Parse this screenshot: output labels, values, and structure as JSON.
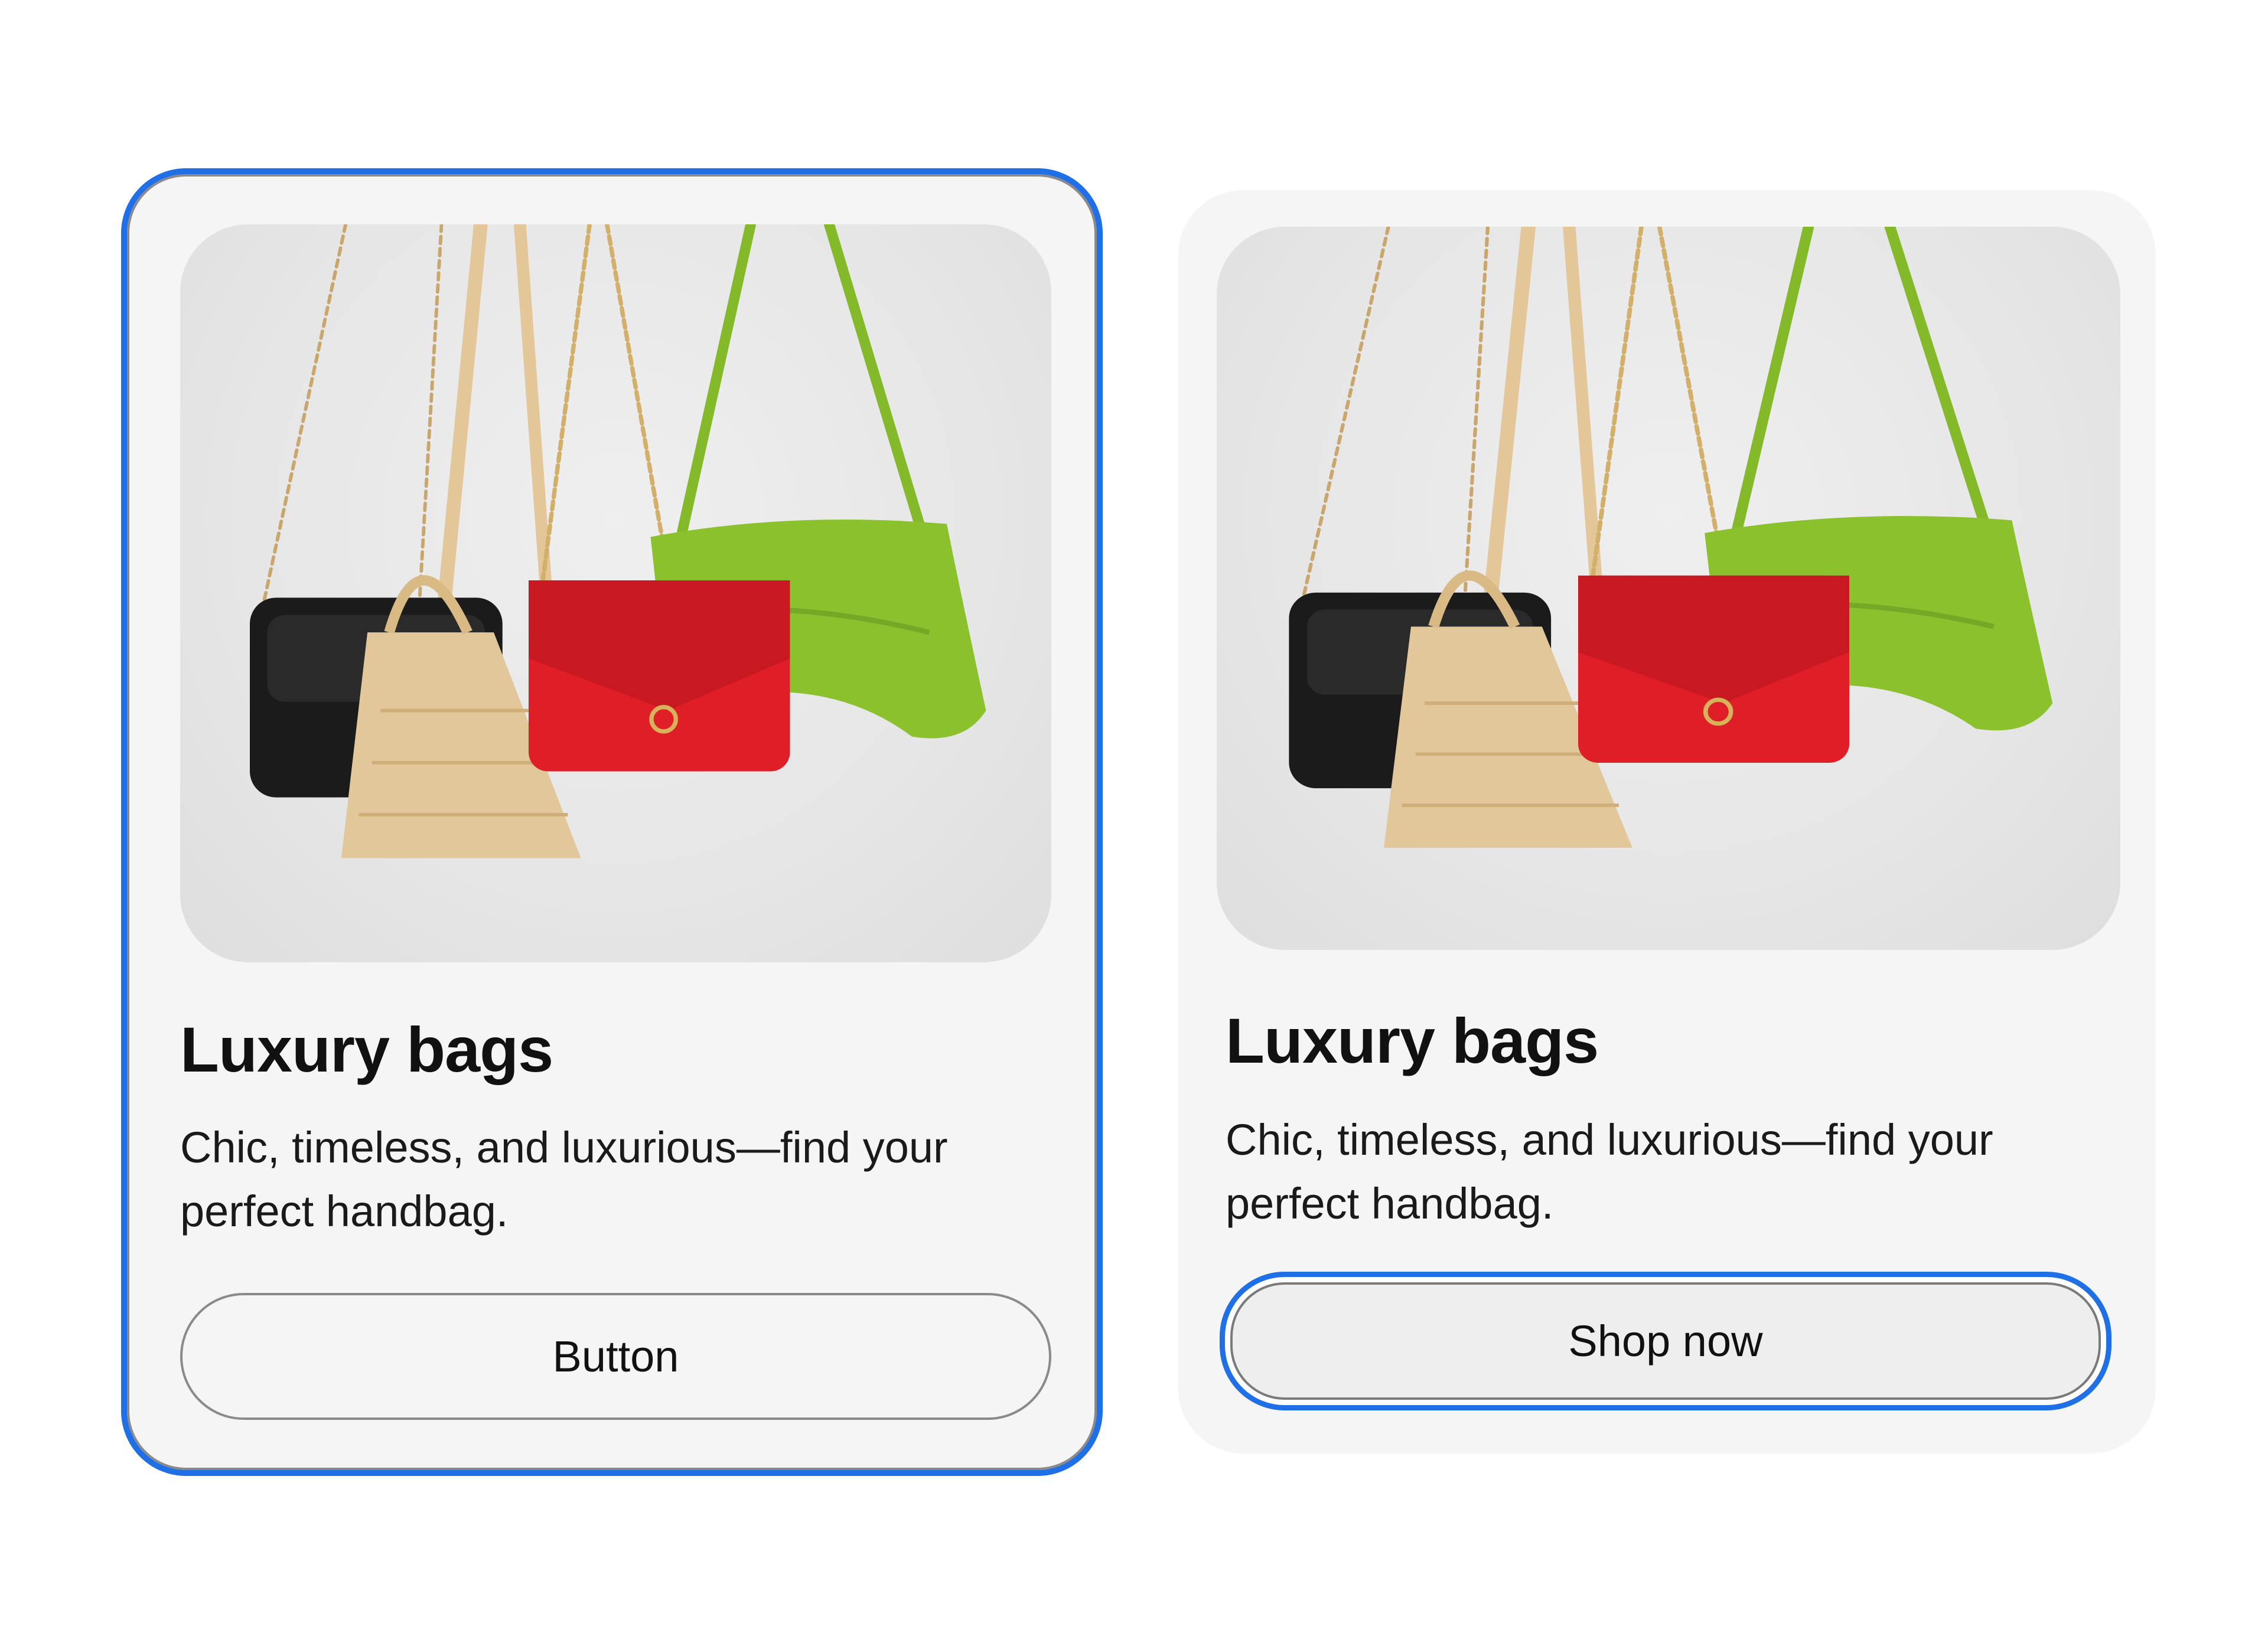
{
  "cards": [
    {
      "image_alt": "Luxury handbags hanging: black crossbody, beige croc tote, red flap bag, green shoulder bag",
      "title": "Luxury bags",
      "description": "Chic, timeless, and luxurious—find your perfect handbag.",
      "button_label": "Button",
      "state": "card-focused"
    },
    {
      "image_alt": "Luxury handbags hanging: black crossbody, beige croc tote, red flap bag, green shoulder bag",
      "title": "Luxury bags",
      "description": "Chic, timeless, and luxurious—find your perfect handbag.",
      "button_label": "Shop now",
      "state": "button-focused"
    }
  ],
  "colors": {
    "focus_ring": "#1f6fe6",
    "card_background": "#f5f5f5",
    "bag_black": "#1b1b1b",
    "bag_beige": "#e2c79a",
    "bag_red": "#e01e28",
    "bag_green": "#8cc12e"
  }
}
